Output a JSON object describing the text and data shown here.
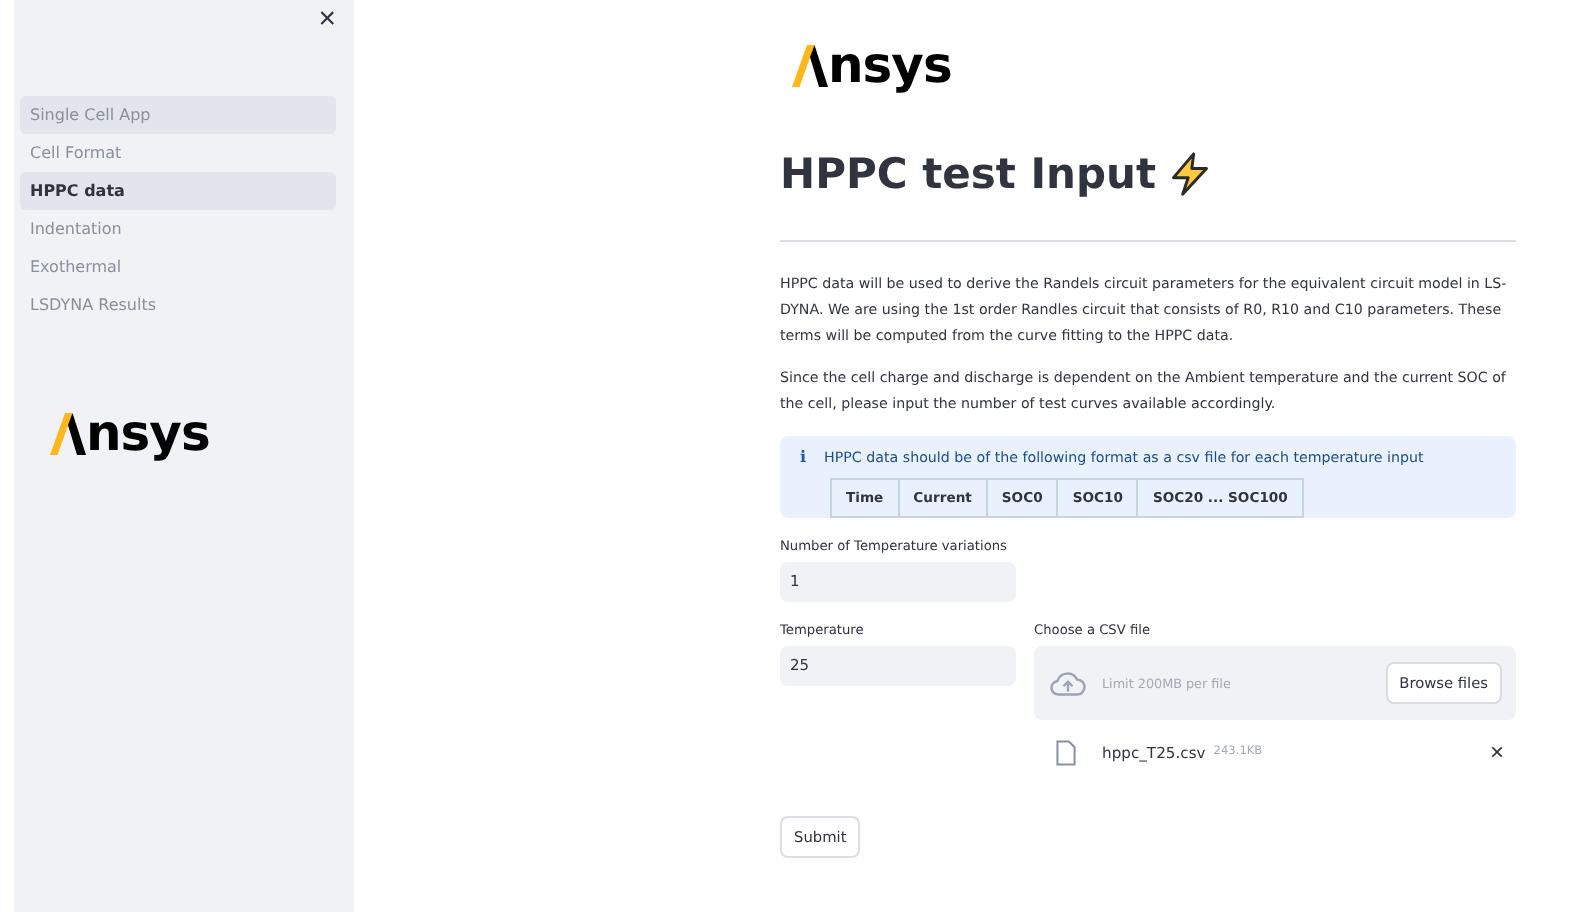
{
  "sidebar": {
    "close": "×",
    "items": [
      {
        "label": "Single Cell App",
        "selected": false,
        "hovered": true
      },
      {
        "label": "Cell Format",
        "selected": false,
        "hovered": false
      },
      {
        "label": "HPPC data",
        "selected": true,
        "hovered": false
      },
      {
        "label": "Indentation",
        "selected": false,
        "hovered": false
      },
      {
        "label": "Exothermal",
        "selected": false,
        "hovered": false
      },
      {
        "label": "LSDYNA Results",
        "selected": false,
        "hovered": false
      }
    ],
    "logo": "nsys"
  },
  "main": {
    "logo": "nsys",
    "title": "HPPC test Input",
    "paragraphs": [
      "HPPC data will be used to derive the Randels circuit parameters for the equivalent circuit model in LS-DYNA. We are using the 1st order Randles circuit that consists of R0, R10 and C10 parameters. These terms will be computed from the curve fitting to the HPPC data.",
      "Since the cell charge and discharge is dependent on the Ambient temperature and the current SOC of the cell, please input the number of test curves available accordingly."
    ],
    "info": {
      "icon": "ℹ",
      "text": "HPPC data should be of the following format as a csv file for each temperature input",
      "columns": [
        "Time",
        "Current",
        "SOC0",
        "SOC10",
        "SOC20 ... SOC100"
      ]
    },
    "variations": {
      "label": "Number of Temperature variations",
      "value": "1"
    },
    "temperature": {
      "label": "Temperature",
      "value": "25"
    },
    "uploader": {
      "label": "Choose a CSV file",
      "hint": "Limit 200MB per file",
      "button": "Browse files",
      "file": {
        "name": "hppc_T25.csv",
        "size": "243.1KB",
        "remove": "×"
      }
    },
    "submit": "Submit"
  }
}
